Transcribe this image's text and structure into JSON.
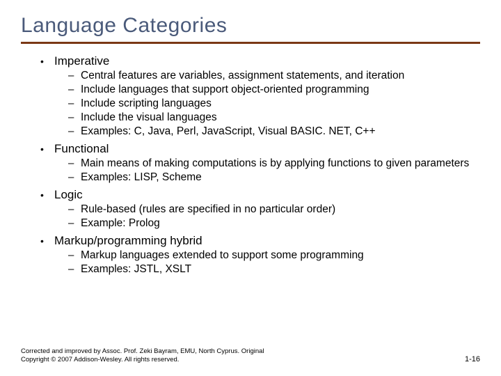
{
  "title": "Language Categories",
  "sections": [
    {
      "heading": "Imperative",
      "items": [
        "Central features are variables, assignment statements, and iteration",
        "Include languages that support object-oriented programming",
        "Include scripting languages",
        "Include the visual languages",
        "Examples: C, Java, Perl, JavaScript, Visual BASIC. NET, C++"
      ]
    },
    {
      "heading": "Functional",
      "items": [
        "Main means of making computations is by applying functions to given parameters",
        "Examples: LISP, Scheme"
      ]
    },
    {
      "heading": "Logic",
      "items": [
        "Rule-based (rules are specified in no particular order)",
        "Example: Prolog"
      ]
    },
    {
      "heading": "Markup/programming hybrid",
      "items": [
        "Markup languages extended to support some programming",
        "Examples: JSTL, XSLT"
      ]
    }
  ],
  "footer_left": "Corrected and improved by Assoc. Prof. Zeki Bayram, EMU, North Cyprus. Original Copyright © 2007 Addison-Wesley. All rights reserved.",
  "footer_right": "1-16"
}
